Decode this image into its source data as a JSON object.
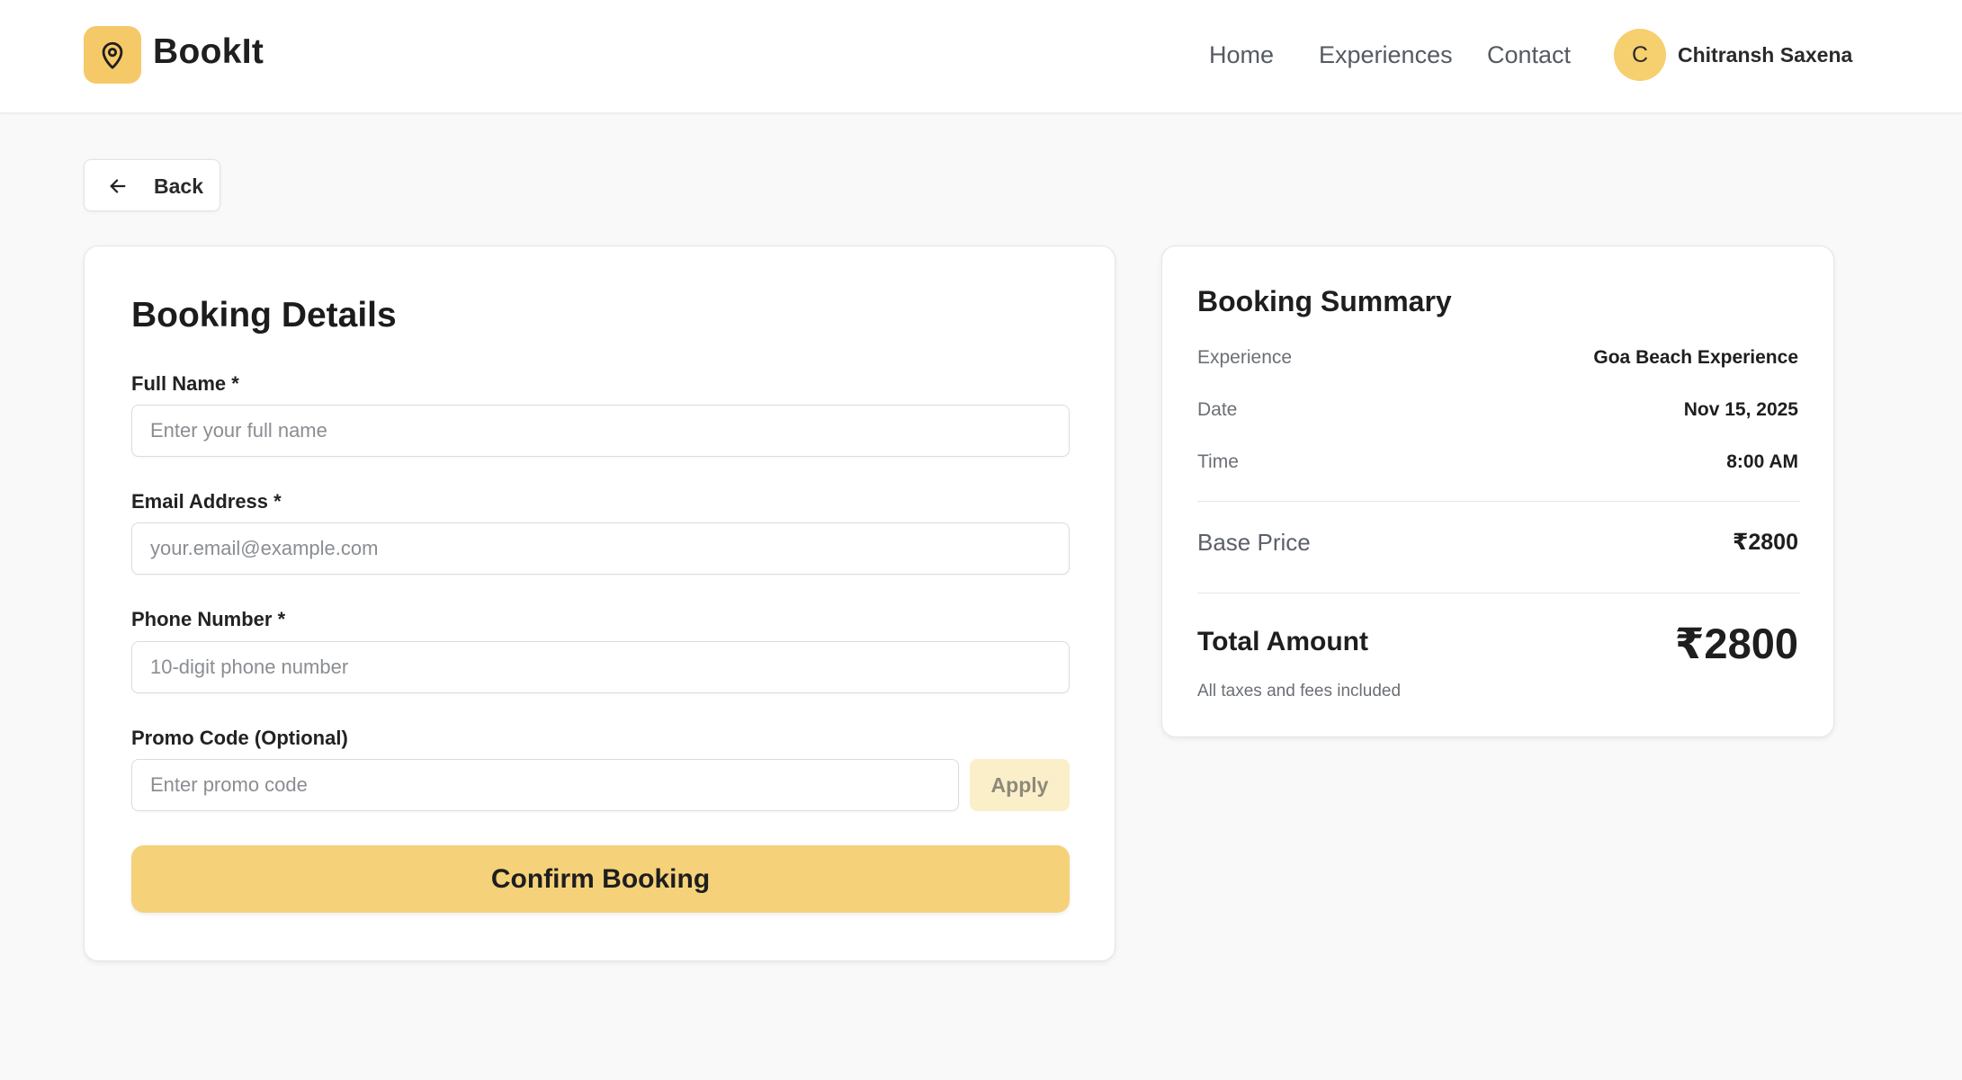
{
  "header": {
    "brand": "BookIt",
    "nav": [
      "Home",
      "Experiences",
      "Contact"
    ],
    "user": {
      "initial": "C",
      "name": "Chitransh Saxena"
    }
  },
  "back": {
    "label": "Back"
  },
  "form": {
    "title": "Booking Details",
    "full_name": {
      "label": "Full Name *",
      "placeholder": "Enter your full name"
    },
    "email": {
      "label": "Email Address *",
      "placeholder": "your.email@example.com"
    },
    "phone": {
      "label": "Phone Number *",
      "placeholder": "10-digit phone number"
    },
    "promo": {
      "label": "Promo Code (Optional)",
      "placeholder": "Enter promo code",
      "apply_label": "Apply"
    },
    "confirm_label": "Confirm Booking"
  },
  "summary": {
    "title": "Booking Summary",
    "rows": [
      {
        "label": "Experience",
        "value": "Goa Beach Experience"
      },
      {
        "label": "Date",
        "value": "Nov 15, 2025"
      },
      {
        "label": "Time",
        "value": "8:00 AM"
      }
    ],
    "base_price": {
      "label": "Base Price",
      "value": "₹2800"
    },
    "total": {
      "label": "Total Amount",
      "value": "₹2800"
    },
    "note": "All taxes and fees included"
  },
  "colors": {
    "accent": "#f6c968",
    "button": "#f5d27a",
    "apply_disabled": "#fbefc9",
    "background": "#f9f9f9"
  },
  "icons": {
    "logo": "map-pin-icon",
    "back": "arrow-left-icon"
  }
}
